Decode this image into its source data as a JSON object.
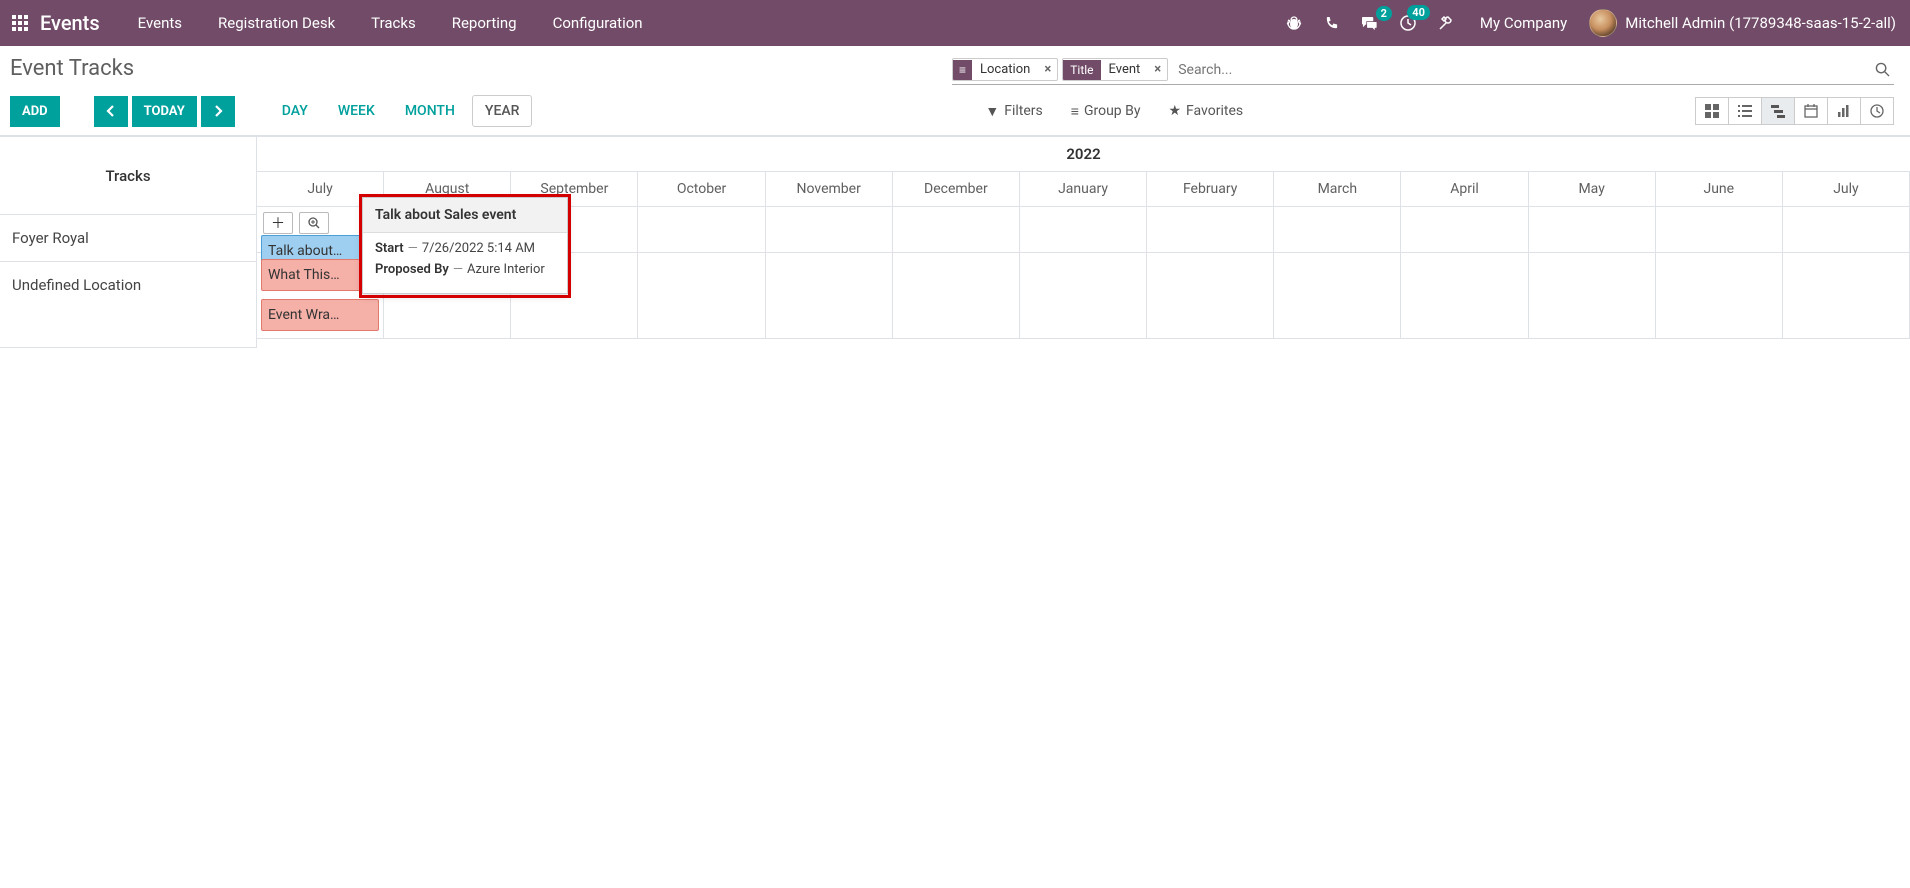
{
  "nav": {
    "brand": "Events",
    "items": [
      "Events",
      "Registration Desk",
      "Tracks",
      "Reporting",
      "Configuration"
    ],
    "msg_badge": "2",
    "activity_badge": "40",
    "company": "My Company",
    "user": "Mitchell Admin (17789348-saas-15-2-all)"
  },
  "cp": {
    "breadcrumb": "Event Tracks",
    "search": {
      "facet1_value": "Location",
      "facet2_label": "Title",
      "facet2_value": "Event",
      "placeholder": "Search..."
    },
    "add": "ADD",
    "today": "TODAY",
    "scales": {
      "day": "DAY",
      "week": "WEEK",
      "month": "MONTH",
      "year": "YEAR"
    },
    "filters": "Filters",
    "groupby": "Group By",
    "favorites": "Favorites"
  },
  "gantt": {
    "side_head": "Tracks",
    "year": "2022",
    "months": [
      "July",
      "August",
      "September",
      "October",
      "November",
      "December",
      "January",
      "February",
      "March",
      "April",
      "May",
      "June",
      "July"
    ],
    "rows": {
      "r1": "Foyer Royal",
      "r2": "Undefined Location"
    },
    "bars": {
      "b1": "Talk about…",
      "b2": "What This…",
      "b3": "Event Wra…"
    }
  },
  "popover": {
    "title": "Talk about Sales event",
    "start_lbl": "Start",
    "start_val": "7/26/2022 5:14 AM",
    "prop_lbl": "Proposed By",
    "prop_val": "Azure Interior"
  }
}
